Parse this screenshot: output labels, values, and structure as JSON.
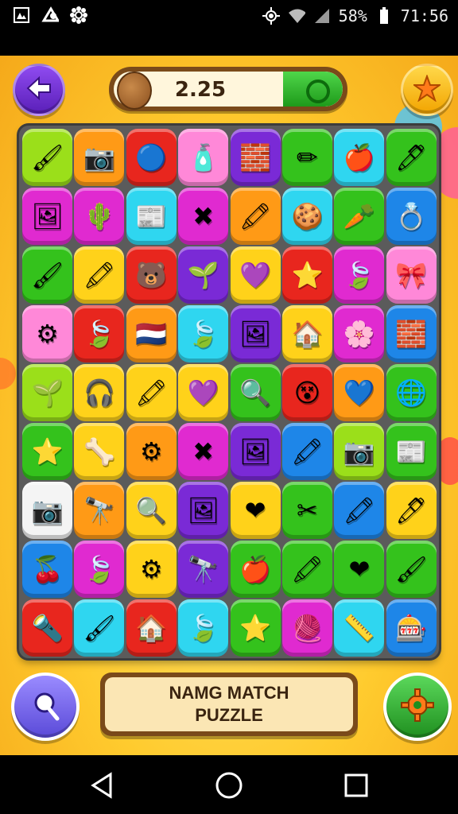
{
  "status_bar": {
    "left_icons": [
      "photo-icon",
      "signal-swirl-icon",
      "flower-icon"
    ],
    "right_icons": [
      "brightness-icon",
      "wifi-icon",
      "cell-signal-icon",
      "battery-icon"
    ],
    "battery_text": "58%",
    "time": "71:56"
  },
  "hud": {
    "score": "2.25",
    "progress_fraction": 0.26,
    "back_icon": "back-arrow-icon",
    "star_icon": "star-icon",
    "acorn_icon": "acorn-icon",
    "check_icon": "check-ring-icon"
  },
  "title_panel": {
    "line1": "NAMG MATCH",
    "line2": "PUZZLE"
  },
  "bottom_buttons": {
    "hint_icon": "magnifier-icon",
    "settings_icon": "gear-icon"
  },
  "colors": {
    "yellow": "#ffd21a",
    "orange": "#ff9a16",
    "red": "#e8261e",
    "green": "#34c21c",
    "lime": "#9bdf1a",
    "blue": "#1e86e8",
    "cyan": "#2fd6f0",
    "purple": "#7a2ad6",
    "magenta": "#e02ad0",
    "pink": "#ff88d8",
    "white": "#f4f4f4",
    "teal": "#1fbfa0"
  },
  "board": {
    "rows": [
      [
        {
          "c": "lime",
          "g": "🖌"
        },
        {
          "c": "orange",
          "g": "📷"
        },
        {
          "c": "red",
          "g": "🔵"
        },
        {
          "c": "pink",
          "g": "🧴"
        },
        {
          "c": "purple",
          "g": "🧱"
        },
        {
          "c": "green",
          "g": "✏"
        },
        {
          "c": "cyan",
          "g": "🍎"
        },
        {
          "c": "green",
          "g": "🖊"
        }
      ],
      [
        {
          "c": "magenta",
          "g": "🖼"
        },
        {
          "c": "magenta",
          "g": "🌵"
        },
        {
          "c": "cyan",
          "g": "📰"
        },
        {
          "c": "magenta",
          "g": "✖"
        },
        {
          "c": "orange",
          "g": "🖍"
        },
        {
          "c": "cyan",
          "g": "🍪"
        },
        {
          "c": "green",
          "g": "🥕"
        },
        {
          "c": "blue",
          "g": "💍"
        }
      ],
      [
        {
          "c": "green",
          "g": "🖌"
        },
        {
          "c": "yellow",
          "g": "🖍"
        },
        {
          "c": "red",
          "g": "🐻"
        },
        {
          "c": "purple",
          "g": "🌱"
        },
        {
          "c": "yellow",
          "g": "💜"
        },
        {
          "c": "red",
          "g": "⭐"
        },
        {
          "c": "magenta",
          "g": "🍃"
        },
        {
          "c": "pink",
          "g": "🎀"
        }
      ],
      [
        {
          "c": "pink",
          "g": "⚙"
        },
        {
          "c": "red",
          "g": "🍃"
        },
        {
          "c": "orange",
          "g": "🇳🇱"
        },
        {
          "c": "cyan",
          "g": "🍃"
        },
        {
          "c": "purple",
          "g": "🖼"
        },
        {
          "c": "yellow",
          "g": "🏠"
        },
        {
          "c": "magenta",
          "g": "🌸"
        },
        {
          "c": "blue",
          "g": "🧱"
        }
      ],
      [
        {
          "c": "lime",
          "g": "🌱"
        },
        {
          "c": "yellow",
          "g": "🎧"
        },
        {
          "c": "yellow",
          "g": "🖍"
        },
        {
          "c": "yellow",
          "g": "💜"
        },
        {
          "c": "green",
          "g": "🔍"
        },
        {
          "c": "red",
          "g": "😵"
        },
        {
          "c": "orange",
          "g": "💙"
        },
        {
          "c": "green",
          "g": "🌐"
        }
      ],
      [
        {
          "c": "green",
          "g": "⭐"
        },
        {
          "c": "yellow",
          "g": "🦴"
        },
        {
          "c": "orange",
          "g": "⚙"
        },
        {
          "c": "magenta",
          "g": "✖"
        },
        {
          "c": "purple",
          "g": "🖼"
        },
        {
          "c": "blue",
          "g": "🖍"
        },
        {
          "c": "lime",
          "g": "📷"
        },
        {
          "c": "green",
          "g": "📰"
        }
      ],
      [
        {
          "c": "white",
          "g": "📷"
        },
        {
          "c": "orange",
          "g": "🔭"
        },
        {
          "c": "yellow",
          "g": "🔍"
        },
        {
          "c": "purple",
          "g": "🖼"
        },
        {
          "c": "yellow",
          "g": "❤"
        },
        {
          "c": "green",
          "g": "✂"
        },
        {
          "c": "blue",
          "g": "🖍"
        },
        {
          "c": "yellow",
          "g": "🖊"
        }
      ],
      [
        {
          "c": "blue",
          "g": "🍒"
        },
        {
          "c": "magenta",
          "g": "🍃"
        },
        {
          "c": "yellow",
          "g": "⚙"
        },
        {
          "c": "purple",
          "g": "🔭"
        },
        {
          "c": "green",
          "g": "🍎"
        },
        {
          "c": "green",
          "g": "🖍"
        },
        {
          "c": "green",
          "g": "❤"
        },
        {
          "c": "green",
          "g": "🖌"
        }
      ],
      [
        {
          "c": "red",
          "g": "🔦"
        },
        {
          "c": "cyan",
          "g": "🖌"
        },
        {
          "c": "red",
          "g": "🏠"
        },
        {
          "c": "cyan",
          "g": "🍃"
        },
        {
          "c": "green",
          "g": "⭐"
        },
        {
          "c": "magenta",
          "g": "🧶"
        },
        {
          "c": "cyan",
          "g": "📏"
        },
        {
          "c": "blue",
          "g": "🎰"
        }
      ]
    ]
  }
}
